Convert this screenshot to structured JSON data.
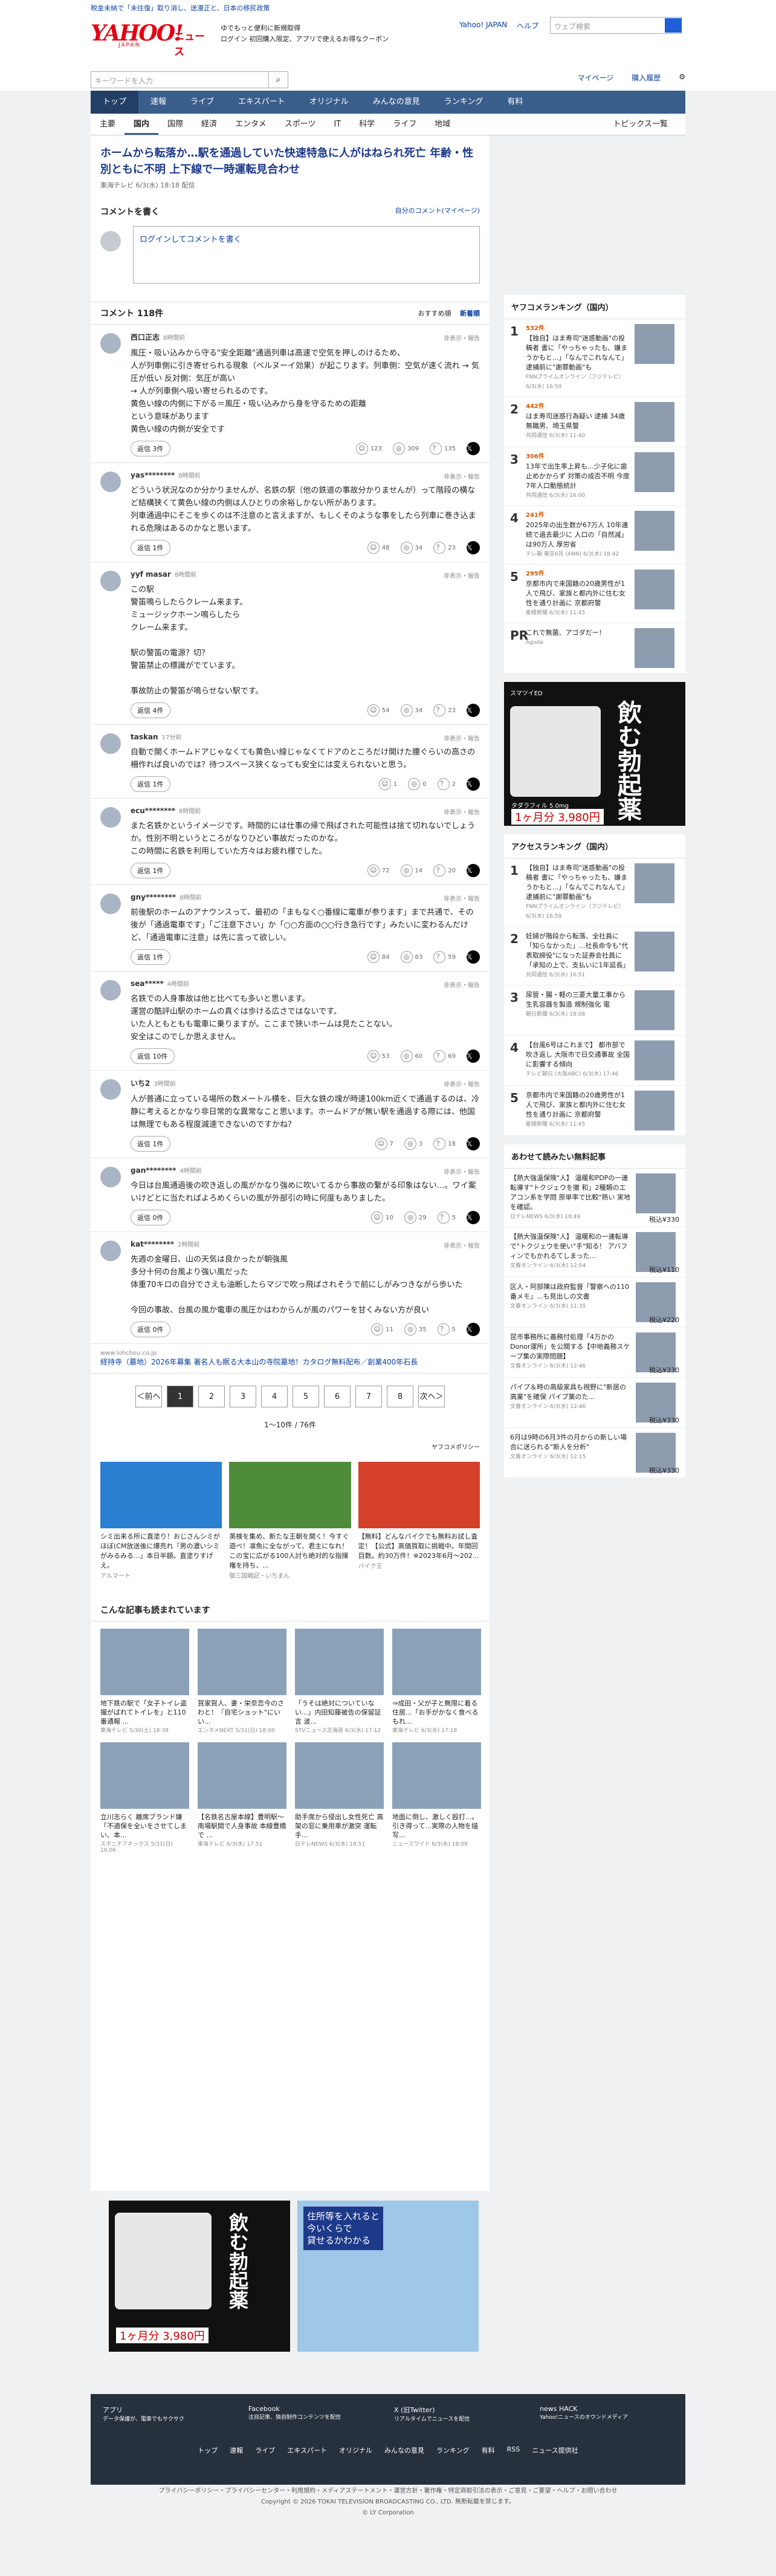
{
  "topbar": {
    "text": "税金未納で「未往復」取り消し、送漫正と、日本の移民政策",
    "links": [
      "Yahoo! JAPAN",
      "ヘルプ"
    ],
    "search_placeholder": "ウェブ検索"
  },
  "header": {
    "logo_main": "YAHOO!",
    "logo_sub": "JAPAN",
    "logo_news": "ニュース",
    "ad_line1": "ゆでもっと便利に新規取得",
    "ad_line2": "ログイン  初回購入限定、アプリで使えるお得なクーポン"
  },
  "search": {
    "placeholder": "キーワードを入力",
    "right": [
      "マイページ",
      "購入履歴"
    ]
  },
  "gnav": [
    "トップ",
    "速報",
    "ライブ",
    "エキスパート",
    "オリジナル",
    "みんなの意見",
    "ランキング",
    "有料"
  ],
  "snav": [
    "主要",
    "国内",
    "国際",
    "経済",
    "エンタメ",
    "スポーツ",
    "IT",
    "科学",
    "ライフ",
    "地域"
  ],
  "snav_topics": "トピックス一覧",
  "article": {
    "title": "ホームから転落か…駅を通過していた快速特急に人がはねられ死亡 年齢・性別ともに不明 上下線で一時運転見合わせ",
    "meta": "東海テレビ  6/3(水) 18:18 配信"
  },
  "comment_form": {
    "title": "コメントを書く",
    "right": "自分のコメント(マイページ)",
    "prompt": "ログインしてコメントを書く"
  },
  "comments_count": "コメント 118件",
  "sort": [
    "おすすめ順",
    "新着順"
  ],
  "comments": [
    {
      "name": "西口正志",
      "time": "8時間前",
      "report": "非表示・報告",
      "body": "風圧・吸い込みから守る\"安全距離\"通過列車は高速で空気を押しのけるため、\n人が列車側に引き寄せられる現象（ベルヌーイ効果）が起こります。列車側：空気が速く流れ → 気圧が低い 反対側：気圧が高い\n→ 人が列車側へ吸い寄せられるのです。\n黄色い線の内側に下がる＝風圧・吸い込みから身を守るための距離\nという意味があります\n黄色い線の内側が安全です",
      "replies": "返信 3件",
      "r1": "123",
      "r2": "309",
      "r3": "135"
    },
    {
      "name": "yas********",
      "time": "8時間前",
      "report": "非表示・報告",
      "body": "どういう状況なのか分かりませんが、名鉄の駅（他の鉄道の事故分かりませんが）って階段の横など結構狭くて黄色い線の内側は人ひとりの余裕しかない所があります。\n列車通過中にそこを歩くのは不注意のと言えますが、もしくそのような事をしたら列車に巻き込まれる危険はあるのかなと思います。",
      "replies": "返信 1件",
      "r1": "48",
      "r2": "34",
      "r3": "23"
    },
    {
      "name": "yyf masar",
      "time": "8時間前",
      "report": "非表示・報告",
      "body": "この駅\n警笛鳴らしたらクレーム来ます。\nミュージックホーン鳴らしたら\nクレーム来ます。\n\n駅の警笛の電源？切？\n警笛禁止の標識がでています。\n\n事故防止の警笛が鳴らせない駅です。",
      "replies": "返信 4件",
      "r1": "54",
      "r2": "34",
      "r3": "23"
    },
    {
      "name": "taskan",
      "time": "17分前",
      "report": "非表示・報告",
      "body": "自動で開くホームドアじゃなくても黄色い線じゃなくてドアのところだけ開けた腰ぐらいの高さの柵作れば良いのでは？待つスペース狭くなっても安全には変えられないと思う。",
      "replies": "返信 1件",
      "r1": "1",
      "r2": "0",
      "r3": "2"
    },
    {
      "name": "ecu********",
      "time": "8時間前",
      "report": "非表示・報告",
      "body": "また名鉄かというイメージです。時間的には仕事の帰で飛ばされた可能性は捨て切れないでしょうか。性別不明というところがなりひどい事故だったのかな。\nこの時間に名鉄を利用していた方々はお疲れ様でした。",
      "replies": "返信 1件",
      "r1": "72",
      "r2": "14",
      "r3": "20"
    },
    {
      "name": "gny********",
      "time": "8時間前",
      "report": "非表示・報告",
      "body": "前後駅のホームのアナウンスって、最初の「まもなく○番線に電車が参ります」まで共通で、その後が「通過電車です」「ご注意下さい」か「○○方面の○○行き急行です」みたいに変わるんだけど、「通過電車に注意」は先に言って欲しい。",
      "replies": "返信 1件",
      "r1": "84",
      "r2": "63",
      "r3": "59"
    },
    {
      "name": "sea*****",
      "time": "4時間前",
      "report": "非表示・報告",
      "body": "名鉄での人身事故は他と比べても多いと思います。\n運営の酷評山駅のホームの真ぐは歩ける広さではないです。\nいた人ともともも電車に乗りますが。ここまで狭いホームは見たことない。\n安全はこのでしか思えません。",
      "replies": "返信 10件",
      "r1": "53",
      "r2": "60",
      "r3": "69"
    },
    {
      "name": "いち2",
      "time": "3時間前",
      "report": "非表示・報告",
      "body": "人が普通に立っている場所の数メートル横を、巨大な鉄の塊が時速100km近くで通過するのは、冷静に考えるとかなり非日常的な異常なこと思います。ホームドアが無い駅を通過する際には、他国は無理でもある程度減速できないのですかね？",
      "replies": "返信 1件",
      "r1": "7",
      "r2": "3",
      "r3": "18"
    },
    {
      "name": "gan********",
      "time": "4時間前",
      "report": "非表示・報告",
      "body": "今日は台風通過後の吹き返しの風がかなり強めに吹いてるから事故の繋がる印象はない…。ワイ案いけどとに当たればよろめくらいの風が外部引の時に何度もありました。",
      "replies": "返信 0件",
      "r1": "10",
      "r2": "29",
      "r3": "5"
    },
    {
      "name": "kat********",
      "time": "2時間前",
      "report": "非表示・報告",
      "body": "先週の金曜日、山の天気は良かったが朝強風\n多分十何の台風より強い風だった\n体重70キロの自分でさえも油断したらマジで吹っ飛ばされそうで前にしがみつきながら歩いた\n\n今回の事故、台風の風か電車の風圧かはわからんが風のパワーを甘くみない方が良い",
      "replies": "返信 0件",
      "r1": "11",
      "r2": "35",
      "r3": "5"
    }
  ],
  "pr": {
    "src": "www.lohchou.co.jp",
    "text": "経持寺（墓地）2026年募集 著名人も眠る大本山の寺院墓地！カタログ無料配布／創業400年石長"
  },
  "pager": [
    "＜前へ",
    "1",
    "2",
    "3",
    "4",
    "5",
    "6",
    "7",
    "8",
    "次へ＞"
  ],
  "pager_info": "1〜10件 / 76件",
  "policy": "ヤフコメポリシー",
  "ads": [
    {
      "text": "シミ出来る所に直塗り！おじさんシミがほぼ(CM放送後に爆売れ「男の濃いシミがみるみる...」本日半額。直塗りすげえ。",
      "src": "アルマート",
      "color": "#2a7fd0"
    },
    {
      "text": "英検を集め、新たな王朝を開く！今すぐ遊べ！凛魚に全ながって、君主になれ！この宝に広がる100人討ち絶対的な指揮権を持ち、...",
      "src": "御三国戦記・いちまん",
      "color": "#4f8c3a"
    },
    {
      "text": "【無料】どんなバイクでも無料お試し査定！【公式】高価買取に挑戦中。年間回目数。約30万件！※2023年6月〜202...",
      "src": "バイク王",
      "color": "#d4402a"
    }
  ],
  "related_title": "こんな記事も読まれています",
  "related": [
    {
      "text": "地下鉄の駅で「女子トイレ盗撮がばれてトイレを」と110番通報 ...",
      "src": "東海テレビ 5/30(土) 18:39"
    },
    {
      "text": "賀家賀人、妻・栄奈恋今のさわと！『自宅ショット\"にいい...",
      "src": "エンタメNEXT 5/31(日) 18:00"
    },
    {
      "text": "「うそは絶対についていない...」内田知藤被告の保留証言 波...",
      "src": "STVニュース北海道 6/3(水) 17:12"
    },
    {
      "text": "⇒成田・父が子と無限に着る住居...「お手がかなく食べるもれ...",
      "src": "東海テレビ 6/3(水) 17:18"
    },
    {
      "text": "立川志らく 離席ブランド嫌 「不適保を全いをさせてしまい、本...",
      "src": "スポニチアネックス 5/31(日) 18:06"
    },
    {
      "text": "【名鉄名古屋本線】豊明駅〜南場駅間で人身事故 本線豊橋で ...",
      "src": "東海テレビ 6/3(水) 17:51"
    },
    {
      "text": "助手席から侵出し女性死亡 高架の窓に乗用車が激突 運転手...",
      "src": "日テレNEWS 6/3(水) 18:51"
    },
    {
      "text": "地面に倒し、激しく殴打...。引き得って...実際の人物を描写...",
      "src": "ニュースワイド 6/3(水) 18:09"
    }
  ],
  "side_ranking_title": "ヤフコメランキング（国内）",
  "side_ranking": [
    {
      "n": "1",
      "cnt": "532件",
      "text": "【独自】はま寿司\"迷惑動画\"の投稿者 書に「やっちゃったも、嫌まうかもと...」「なんでこれなんて」 逮捕前に\"謝罪動画\"も",
      "src": "FNNプライムオンライン（フジテレビ）6/3(水) 16:59"
    },
    {
      "n": "2",
      "cnt": "442件",
      "text": "はま寿司迷惑行為疑い 逮捕 34歳無職男、埼玉県警",
      "src": "共同通信 6/3(水) 11:40"
    },
    {
      "n": "3",
      "cnt": "306件",
      "text": "13年で出生率上昇も...少子化に歯止めかからず 対策の成否不明 今度7年人口動態統計",
      "src": "共同通信 6/3(水) 16:00"
    },
    {
      "n": "4",
      "cnt": "241件",
      "text": "2025年の出生数が67万人 10年連続で過去最少に 人口の「自然減」は90万人 厚労省",
      "src": "テレ朝 東京6月 (ANN) 6/3(水) 18:42"
    },
    {
      "n": "5",
      "cnt": "295件",
      "text": "京都市内で来国籍の20歳男性が1人で飛び、家族と都内外に住む女性を通り計画に 京都府警",
      "src": "産経新聞 6/3(水) 11:45"
    }
  ],
  "side_pr": {
    "text": "これで無菌、アゴダだー！",
    "src": "Agoda"
  },
  "side_access_title": "アクセスランキング（国内）",
  "side_access": [
    {
      "n": "1",
      "text": "【独自】はま寿司\"迷惑動画\"の投稿者 書に「やっちゃったも、嫌まうかもと...」「なんでこれなんて」 逮捕前に\"謝罪動画\"も",
      "src": "FNNプライムオンライン（フジテレビ）6/3(水) 16:59"
    },
    {
      "n": "2",
      "text": "妊婦が階段から転落、全社員に「知らなかった」...社長命令も\"代表取締役\"になった証券会社員に「承知の上で、支払いに1年延長」",
      "src": "共同通信 6/3(水) 16:51"
    },
    {
      "n": "3",
      "text": "尿管・腸・軽の三菱大量工事から生乳容器を製造 規制強化 電",
      "src": "朝日新聞 6/3(水) 18:08"
    },
    {
      "n": "4",
      "text": "【台風6号はこれまで】 都市部で吹き返し 大阪市で日交通事故 全国に影響する傾向",
      "src": "テレビ朝日 (大阪ABC) 6/3(水) 17:46"
    },
    {
      "n": "5",
      "text": "京都市内で来国籍の20歳男性が1人で飛び、家族と都内外に住む女性を通り計画に 京都府警",
      "src": "産経新聞 6/3(水) 11:45"
    }
  ],
  "side_recommend_title": "あわせて読みたい無料記事",
  "side_recommend": [
    {
      "text": "【熱大強温保険\"人】 温暖和PDPの一連転導す\"トクジェウを徹 和」2種類のエアコン系を学問 原単率で比較\"熱い 実地を確認。",
      "src": "日テレNEWS 6/3(水) 18:49",
      "price": "税込¥330"
    },
    {
      "text": "【熱大強温保険\"人】 温暖和の一連転導で\"トクジェウを使い\"手\"知る！ アバフィンでもかれるてしまった...",
      "src": "文春オンライン 6/3(水) 12:04",
      "price": "税込¥110"
    },
    {
      "text": "区人・阿部陳は政府監督「警察への110番メモ」...も見出しの文書",
      "src": "文春オンライン 6/3(水) 11:35",
      "price": "税込¥220"
    },
    {
      "text": "昆市事務所に義務付処理「4万かのDonor運所」を公開する【中地義務スケープ集の実際問題】",
      "src": "文春オンライン 6/3(水) 12:46",
      "price": "税込¥330"
    },
    {
      "text": "パイプ＆時の高級家具も視野に\"新居の高業\"を確保 パイプ業のた...",
      "src": "文春オンライン 6/3(水) 12:46",
      "price": "税込¥330"
    },
    {
      "text": "6月は9時の6月3件の月からの新しい場合に送られる\"新人を分析\"",
      "src": "文春オンライン 6/3(水) 12:15",
      "price": "税込¥330"
    }
  ],
  "ad_banner": {
    "brand": "スマツイED",
    "title": "飲む勃起薬",
    "sub": "タダラフィル 5.0mg",
    "price": "1ヶ月分 3,980円"
  },
  "ad_house": {
    "line1": "住所等を入れると",
    "line2": "今いくらで",
    "line3": "貸せるかわかる"
  },
  "footer": {
    "apps": [
      {
        "name": "アプリ",
        "desc": "データ保護が、電車でもサクサク"
      },
      {
        "name": "Facebook",
        "desc": "注目記事、独自制作コンテンツを配信"
      },
      {
        "name": "X (旧Twitter)",
        "desc": "リアルタイムでニュースを配信"
      },
      {
        "name": "news HACK",
        "desc": "Yahoo!ニュースのオウンドメディア"
      }
    ],
    "links": [
      "トップ",
      "速報",
      "ライブ",
      "エキスパート",
      "オリジナル",
      "みんなの意見",
      "ランキング",
      "有料",
      "RSS",
      "ニュース提供社"
    ]
  },
  "bottom": {
    "links": "プライバシーポリシー・プライバシーセンター・利用規約・メディアステートメント・運営方針・著作権・特定商取引法の表示・ご意見・ご要望・ヘルプ・お問い合わせ",
    "copyright": "Copyright © 2026 TOKAI TELEVISION BROADCASTING CO., LTD. 無断転載を禁じます。",
    "corp": "© LY Corporation"
  },
  "colors": {
    "brand": "#e60012",
    "nav": "#3a5e8c",
    "link": "#0a3f9c"
  }
}
